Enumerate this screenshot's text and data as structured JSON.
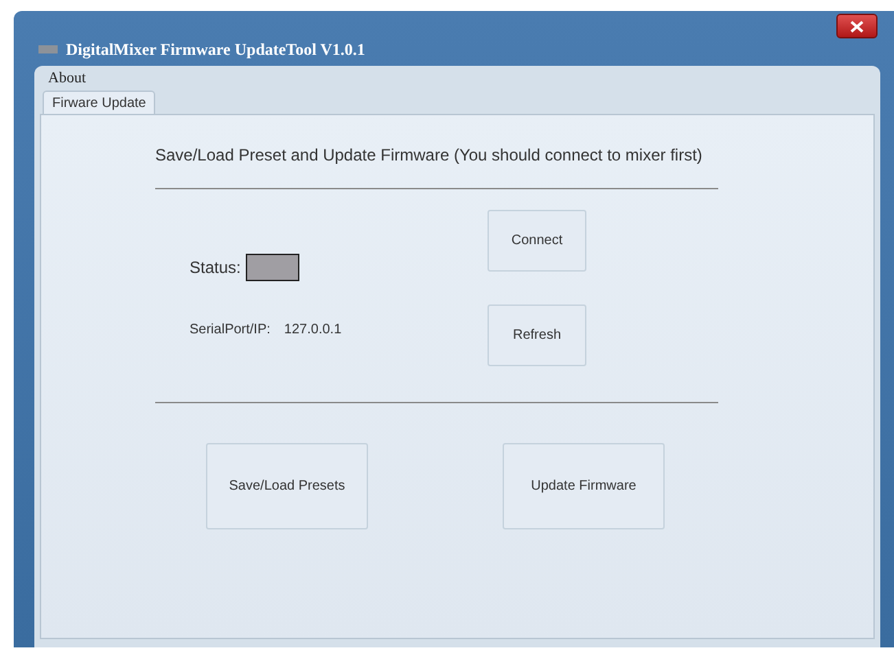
{
  "window": {
    "title": "DigitalMixer Firmware UpdateTool V1.0.1"
  },
  "menu": [
    "About"
  ],
  "tabs": [
    {
      "label": "Firware Update",
      "selected": true
    }
  ],
  "heading": "Save/Load Preset and Update Firmware (You should connect to mixer first)",
  "status": {
    "label": "Status:",
    "connected": false
  },
  "serial": {
    "label": "SerialPort/IP:",
    "value": "127.0.0.1"
  },
  "connect_button": "Connect",
  "refresh_button": "Refresh",
  "actions": [
    "Save/Load Presets",
    "Update Firmware"
  ]
}
